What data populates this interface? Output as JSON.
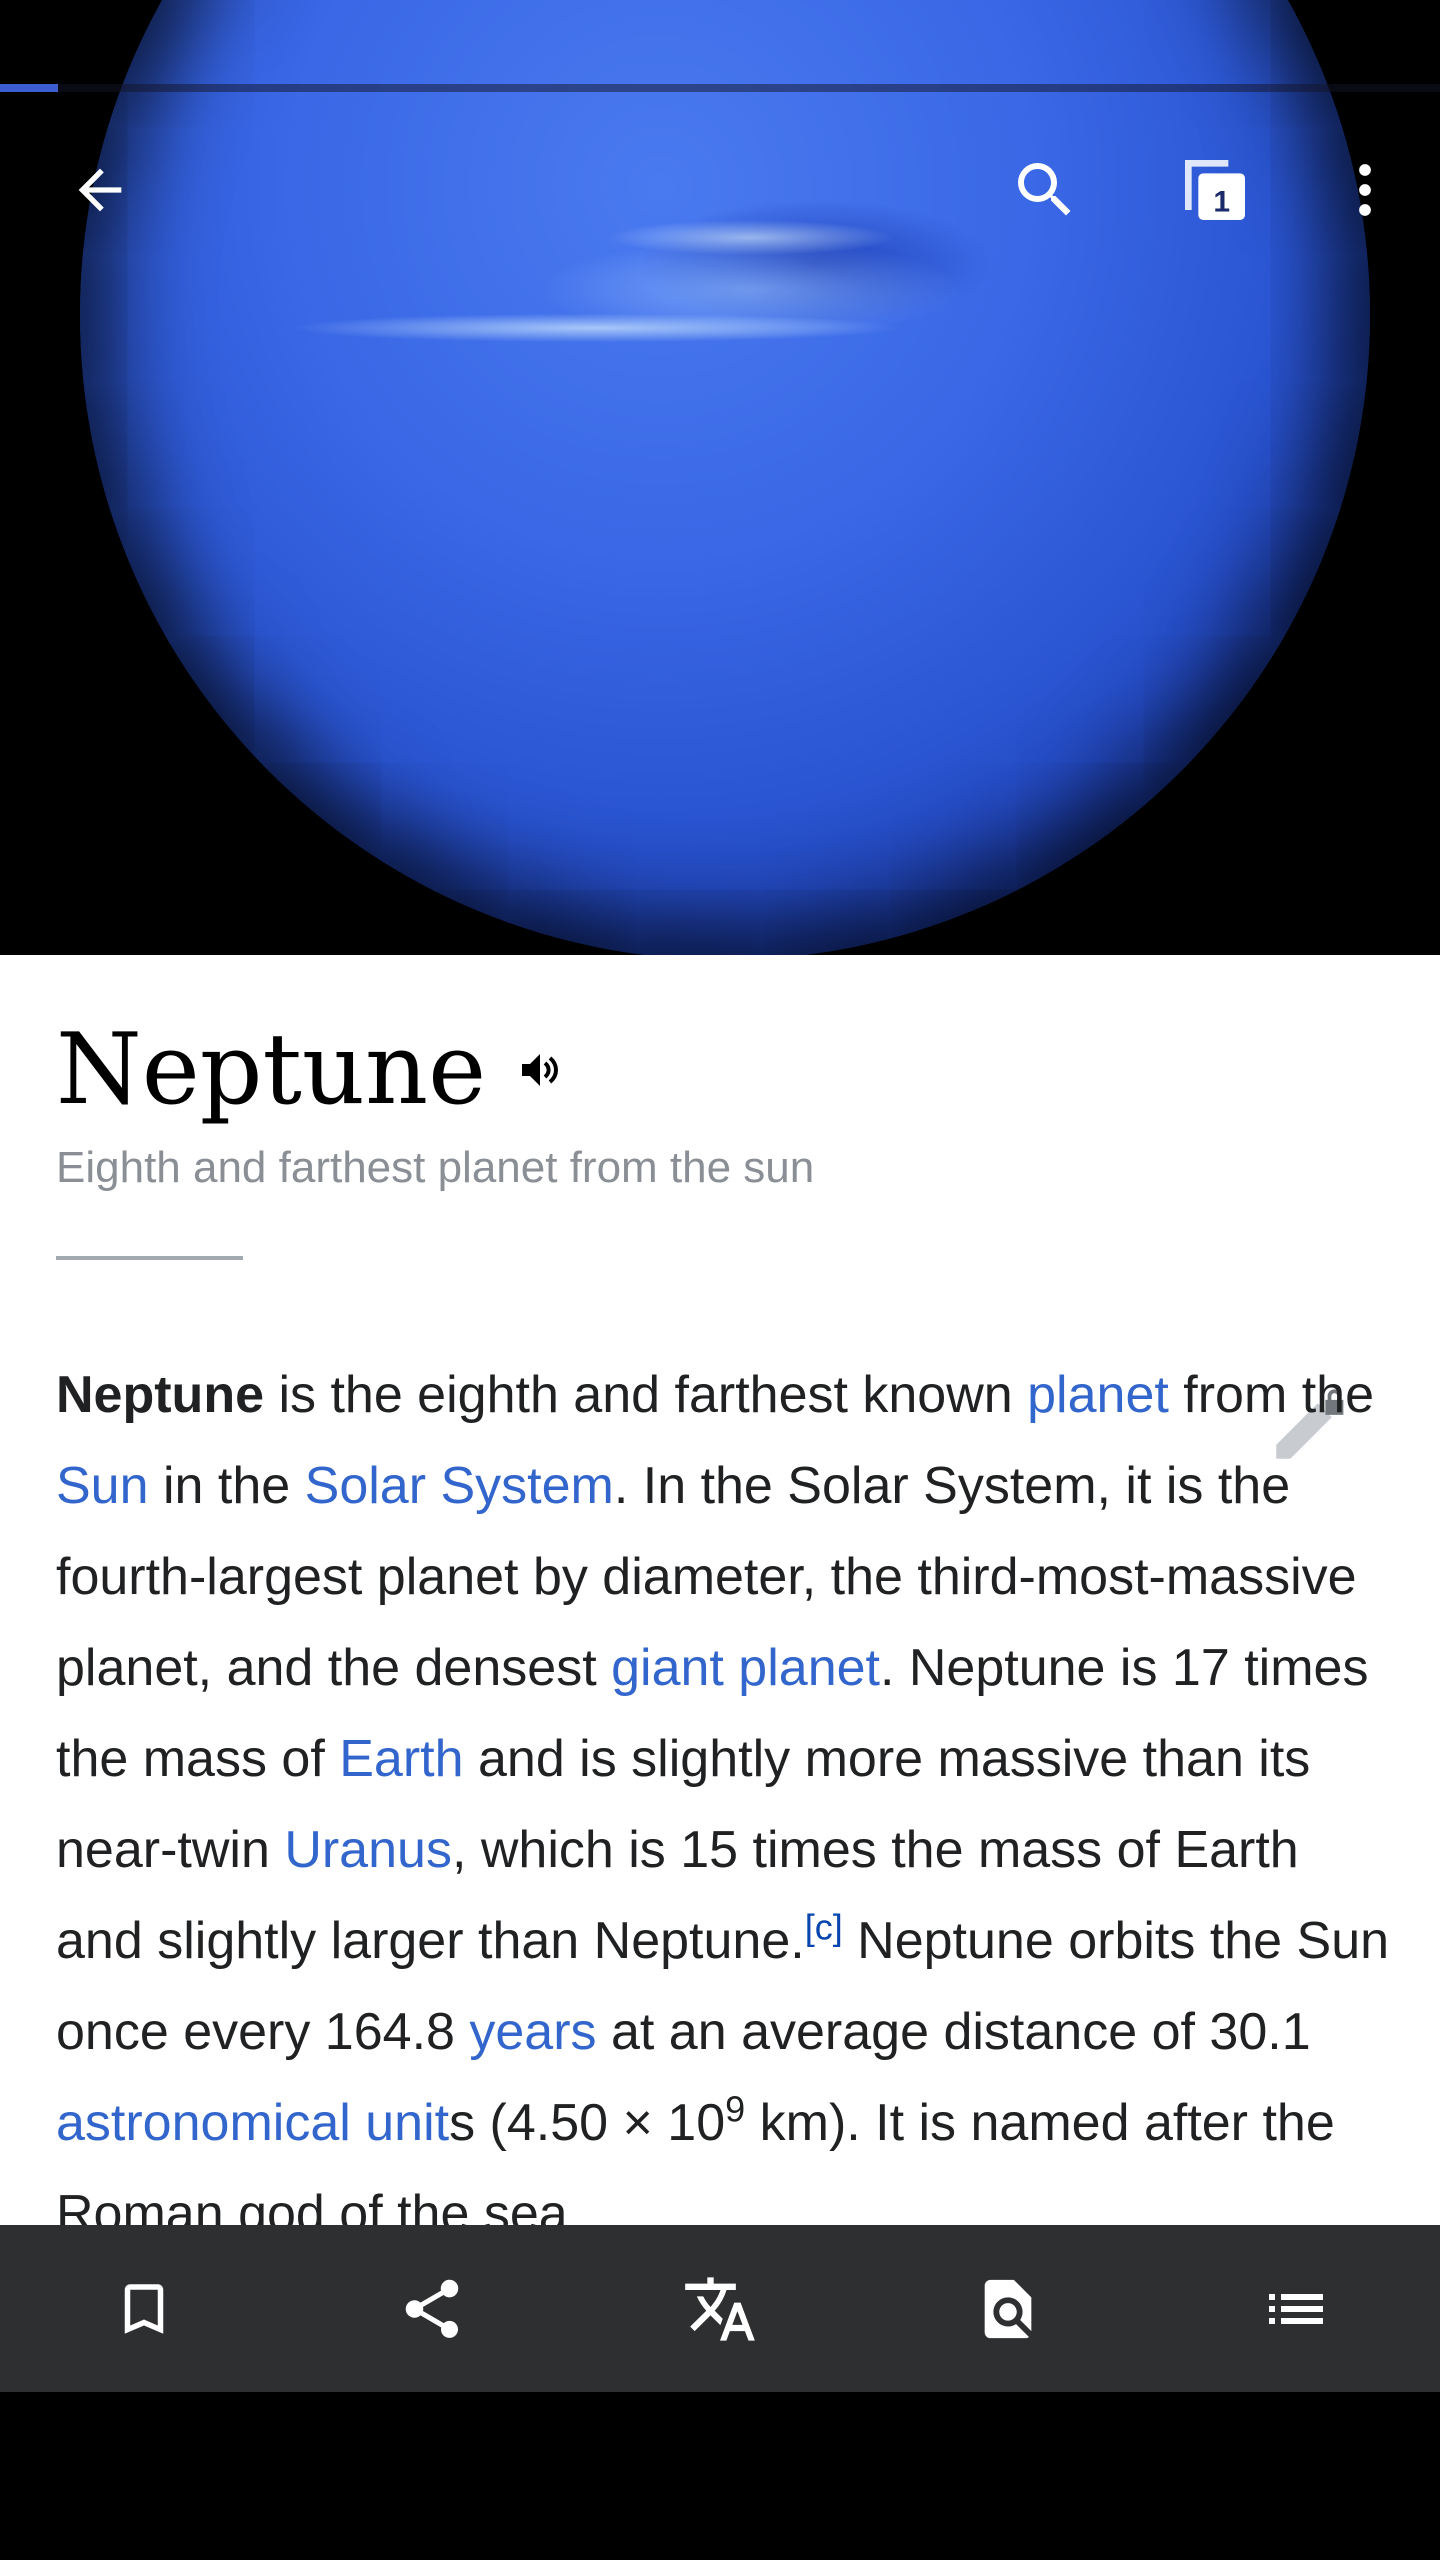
{
  "hero": {
    "progress_fraction": 0.04,
    "tabs_count": "1"
  },
  "article": {
    "title": "Neptune",
    "subtitle": "Eighth and farthest planet from the sun",
    "paragraph": [
      {
        "t": "b",
        "v": "Neptune"
      },
      {
        "t": "s",
        "v": " is the eighth and farthest known "
      },
      {
        "t": "a",
        "v": "planet"
      },
      {
        "t": "s",
        "v": " from the "
      },
      {
        "t": "a",
        "v": "Sun"
      },
      {
        "t": "s",
        "v": " in the "
      },
      {
        "t": "a",
        "v": "Solar System"
      },
      {
        "t": "s",
        "v": ". In the Solar System, it is the fourth-largest planet by diameter, the third-most-massive planet, and the densest "
      },
      {
        "t": "a",
        "v": "giant planet"
      },
      {
        "t": "s",
        "v": ". Neptune is 17 times the mass of "
      },
      {
        "t": "a",
        "v": "Earth"
      },
      {
        "t": "s",
        "v": " and is slightly more massive than its near-twin "
      },
      {
        "t": "a",
        "v": "Uranus"
      },
      {
        "t": "s",
        "v": ", which is 15 times the mass of Earth and slightly larger than Neptune."
      },
      {
        "t": "sup",
        "v": "[c]"
      },
      {
        "t": "s",
        "v": " Neptune orbits the Sun once every 164.8 "
      },
      {
        "t": "a",
        "v": "years"
      },
      {
        "t": "s",
        "v": " at an average distance of 30.1 "
      },
      {
        "t": "a",
        "v": "astronomical unit"
      },
      {
        "t": "s",
        "v": "s (4.50 × 10"
      },
      {
        "t": "supplain",
        "v": "9"
      },
      {
        "t": "s",
        "v": " km). It is named after the Roman god of the sea."
      }
    ]
  },
  "bottom_bar": {
    "items": [
      "bookmark-icon",
      "share-icon",
      "translate-icon",
      "find-in-page-icon",
      "contents-icon"
    ]
  },
  "colors": {
    "link": "#3366cc",
    "bar": "#2e2f31",
    "accent": "#3b5fd0"
  }
}
